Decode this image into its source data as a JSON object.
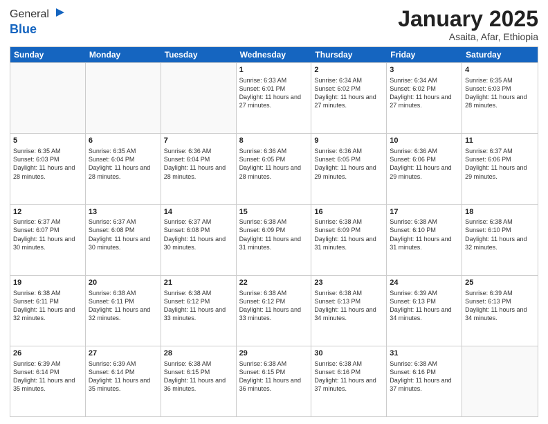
{
  "logo": {
    "general": "General",
    "blue": "Blue"
  },
  "title": "January 2025",
  "location": "Asaita, Afar, Ethiopia",
  "days_of_week": [
    "Sunday",
    "Monday",
    "Tuesday",
    "Wednesday",
    "Thursday",
    "Friday",
    "Saturday"
  ],
  "weeks": [
    [
      {
        "day": "",
        "info": ""
      },
      {
        "day": "",
        "info": ""
      },
      {
        "day": "",
        "info": ""
      },
      {
        "day": "1",
        "info": "Sunrise: 6:33 AM\nSunset: 6:01 PM\nDaylight: 11 hours and 27 minutes."
      },
      {
        "day": "2",
        "info": "Sunrise: 6:34 AM\nSunset: 6:02 PM\nDaylight: 11 hours and 27 minutes."
      },
      {
        "day": "3",
        "info": "Sunrise: 6:34 AM\nSunset: 6:02 PM\nDaylight: 11 hours and 27 minutes."
      },
      {
        "day": "4",
        "info": "Sunrise: 6:35 AM\nSunset: 6:03 PM\nDaylight: 11 hours and 28 minutes."
      }
    ],
    [
      {
        "day": "5",
        "info": "Sunrise: 6:35 AM\nSunset: 6:03 PM\nDaylight: 11 hours and 28 minutes."
      },
      {
        "day": "6",
        "info": "Sunrise: 6:35 AM\nSunset: 6:04 PM\nDaylight: 11 hours and 28 minutes."
      },
      {
        "day": "7",
        "info": "Sunrise: 6:36 AM\nSunset: 6:04 PM\nDaylight: 11 hours and 28 minutes."
      },
      {
        "day": "8",
        "info": "Sunrise: 6:36 AM\nSunset: 6:05 PM\nDaylight: 11 hours and 28 minutes."
      },
      {
        "day": "9",
        "info": "Sunrise: 6:36 AM\nSunset: 6:05 PM\nDaylight: 11 hours and 29 minutes."
      },
      {
        "day": "10",
        "info": "Sunrise: 6:36 AM\nSunset: 6:06 PM\nDaylight: 11 hours and 29 minutes."
      },
      {
        "day": "11",
        "info": "Sunrise: 6:37 AM\nSunset: 6:06 PM\nDaylight: 11 hours and 29 minutes."
      }
    ],
    [
      {
        "day": "12",
        "info": "Sunrise: 6:37 AM\nSunset: 6:07 PM\nDaylight: 11 hours and 30 minutes."
      },
      {
        "day": "13",
        "info": "Sunrise: 6:37 AM\nSunset: 6:08 PM\nDaylight: 11 hours and 30 minutes."
      },
      {
        "day": "14",
        "info": "Sunrise: 6:37 AM\nSunset: 6:08 PM\nDaylight: 11 hours and 30 minutes."
      },
      {
        "day": "15",
        "info": "Sunrise: 6:38 AM\nSunset: 6:09 PM\nDaylight: 11 hours and 31 minutes."
      },
      {
        "day": "16",
        "info": "Sunrise: 6:38 AM\nSunset: 6:09 PM\nDaylight: 11 hours and 31 minutes."
      },
      {
        "day": "17",
        "info": "Sunrise: 6:38 AM\nSunset: 6:10 PM\nDaylight: 11 hours and 31 minutes."
      },
      {
        "day": "18",
        "info": "Sunrise: 6:38 AM\nSunset: 6:10 PM\nDaylight: 11 hours and 32 minutes."
      }
    ],
    [
      {
        "day": "19",
        "info": "Sunrise: 6:38 AM\nSunset: 6:11 PM\nDaylight: 11 hours and 32 minutes."
      },
      {
        "day": "20",
        "info": "Sunrise: 6:38 AM\nSunset: 6:11 PM\nDaylight: 11 hours and 32 minutes."
      },
      {
        "day": "21",
        "info": "Sunrise: 6:38 AM\nSunset: 6:12 PM\nDaylight: 11 hours and 33 minutes."
      },
      {
        "day": "22",
        "info": "Sunrise: 6:38 AM\nSunset: 6:12 PM\nDaylight: 11 hours and 33 minutes."
      },
      {
        "day": "23",
        "info": "Sunrise: 6:38 AM\nSunset: 6:13 PM\nDaylight: 11 hours and 34 minutes."
      },
      {
        "day": "24",
        "info": "Sunrise: 6:39 AM\nSunset: 6:13 PM\nDaylight: 11 hours and 34 minutes."
      },
      {
        "day": "25",
        "info": "Sunrise: 6:39 AM\nSunset: 6:13 PM\nDaylight: 11 hours and 34 minutes."
      }
    ],
    [
      {
        "day": "26",
        "info": "Sunrise: 6:39 AM\nSunset: 6:14 PM\nDaylight: 11 hours and 35 minutes."
      },
      {
        "day": "27",
        "info": "Sunrise: 6:39 AM\nSunset: 6:14 PM\nDaylight: 11 hours and 35 minutes."
      },
      {
        "day": "28",
        "info": "Sunrise: 6:38 AM\nSunset: 6:15 PM\nDaylight: 11 hours and 36 minutes."
      },
      {
        "day": "29",
        "info": "Sunrise: 6:38 AM\nSunset: 6:15 PM\nDaylight: 11 hours and 36 minutes."
      },
      {
        "day": "30",
        "info": "Sunrise: 6:38 AM\nSunset: 6:16 PM\nDaylight: 11 hours and 37 minutes."
      },
      {
        "day": "31",
        "info": "Sunrise: 6:38 AM\nSunset: 6:16 PM\nDaylight: 11 hours and 37 minutes."
      },
      {
        "day": "",
        "info": ""
      }
    ]
  ]
}
